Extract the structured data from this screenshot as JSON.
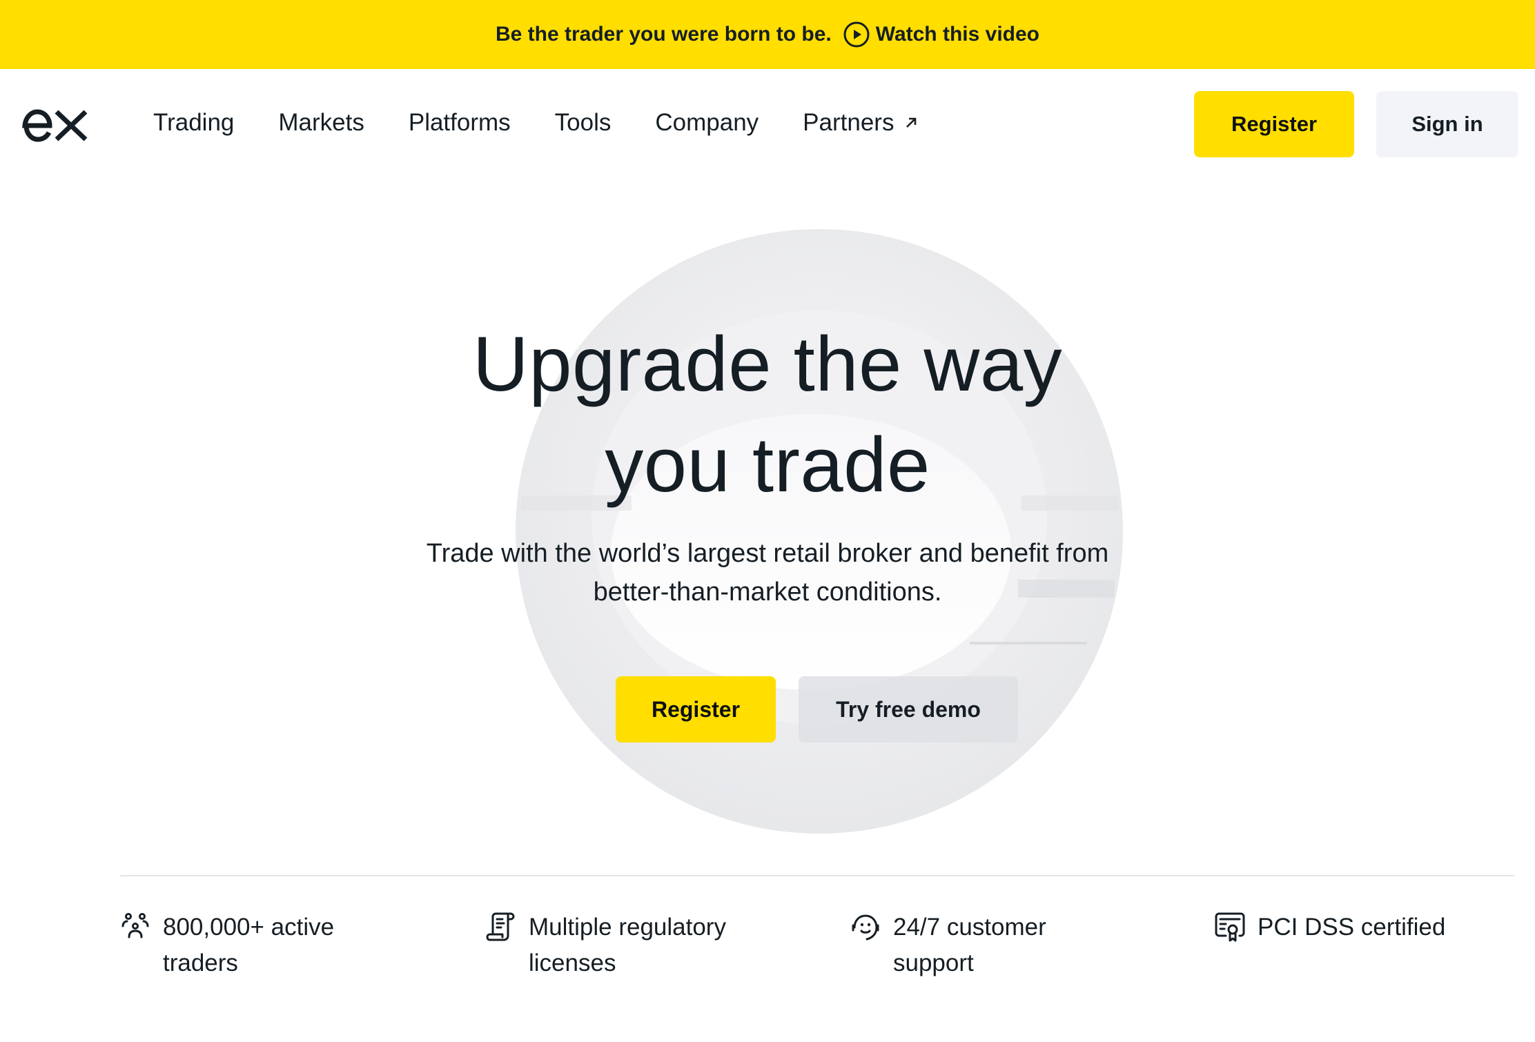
{
  "promo": {
    "text": "Be the trader you were born to be.",
    "link_label": "Watch this video",
    "link_icon": "play-circle-icon"
  },
  "header": {
    "logo_text": "ex",
    "nav": [
      {
        "label": "Trading"
      },
      {
        "label": "Markets"
      },
      {
        "label": "Platforms"
      },
      {
        "label": "Tools"
      },
      {
        "label": "Company"
      },
      {
        "label": "Partners",
        "icon": "external-arrow-icon"
      }
    ],
    "register_label": "Register",
    "signin_label": "Sign in"
  },
  "hero": {
    "title_line1": "Upgrade the way",
    "title_line2": "you trade",
    "subtitle_line1": "Trade with the world’s largest retail broker and benefit from",
    "subtitle_line2": "better-than-market conditions.",
    "register_label": "Register",
    "demo_label": "Try free demo"
  },
  "features": [
    {
      "icon": "users-icon",
      "line1": "800,000+ active",
      "line2": "traders"
    },
    {
      "icon": "license-scroll-icon",
      "line1": "Multiple regulatory",
      "line2": "licenses"
    },
    {
      "icon": "support-headset-icon",
      "line1": "24/7 customer",
      "line2": "support"
    },
    {
      "icon": "certificate-icon",
      "line1": "PCI DSS certified",
      "line2": ""
    }
  ],
  "colors": {
    "accent_yellow": "#ffde00",
    "text_dark": "#151e24",
    "secondary_button": "#f3f4f7",
    "divider": "#e4e4e4"
  }
}
